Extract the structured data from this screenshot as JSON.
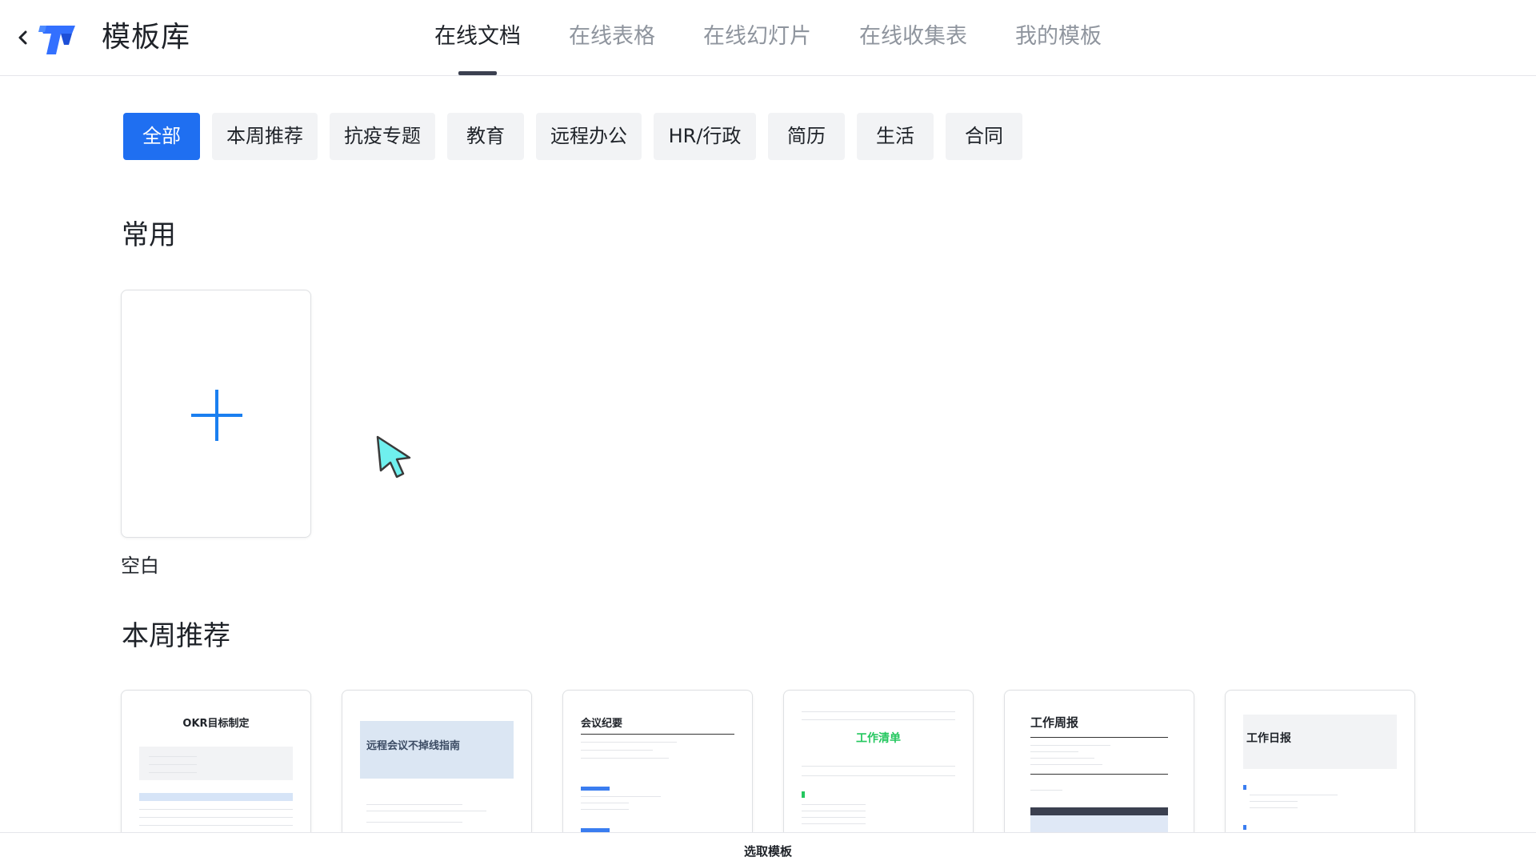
{
  "header": {
    "title": "模板库",
    "tabs": [
      {
        "label": "在线文档",
        "active": true
      },
      {
        "label": "在线表格",
        "active": false
      },
      {
        "label": "在线幻灯片",
        "active": false
      },
      {
        "label": "在线收集表",
        "active": false
      },
      {
        "label": "我的模板",
        "active": false
      }
    ]
  },
  "filters": [
    {
      "label": "全部",
      "active": true
    },
    {
      "label": "本周推荐",
      "active": false
    },
    {
      "label": "抗疫专题",
      "active": false
    },
    {
      "label": "教育",
      "active": false
    },
    {
      "label": "远程办公",
      "active": false
    },
    {
      "label": "HR/行政",
      "active": false
    },
    {
      "label": "简历",
      "active": false
    },
    {
      "label": "生活",
      "active": false
    },
    {
      "label": "合同",
      "active": false
    }
  ],
  "common": {
    "title": "常用",
    "blank_label": "空白"
  },
  "weekly": {
    "title": "本周推荐",
    "templates": [
      {
        "title": "OKR目标制定"
      },
      {
        "title": "远程会议不掉线指南"
      },
      {
        "title": "会议纪要"
      },
      {
        "title": "工作清单"
      },
      {
        "title": "工作周报"
      },
      {
        "title": "工作日报"
      }
    ]
  },
  "footer": {
    "label": "选取模板"
  },
  "colors": {
    "accent": "#1f6ff1",
    "plus": "#1a7ff0",
    "green": "#24c75f"
  }
}
